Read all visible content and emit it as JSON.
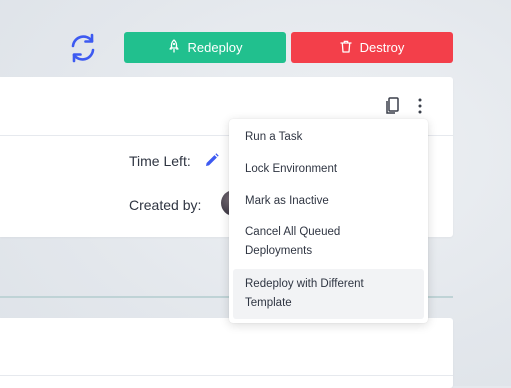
{
  "header": {
    "refresh_icon": "refresh-icon",
    "redeploy_label": "Redeploy",
    "redeploy_icon": "rocket-icon",
    "destroy_label": "Destroy",
    "destroy_icon": "trash-icon"
  },
  "colors": {
    "accent": "#3d5af1",
    "redeploy": "#21c08e",
    "destroy": "#f33f4a"
  },
  "details": {
    "time_left_label": "Time Left:",
    "created_by_label": "Created by:"
  },
  "actions_menu": {
    "items": [
      {
        "label": "Run a Task"
      },
      {
        "label": "Lock Environment"
      },
      {
        "label": "Mark as Inactive"
      },
      {
        "label": "Cancel All Queued Deployments"
      },
      {
        "label": "Redeploy with Different Template"
      }
    ]
  }
}
